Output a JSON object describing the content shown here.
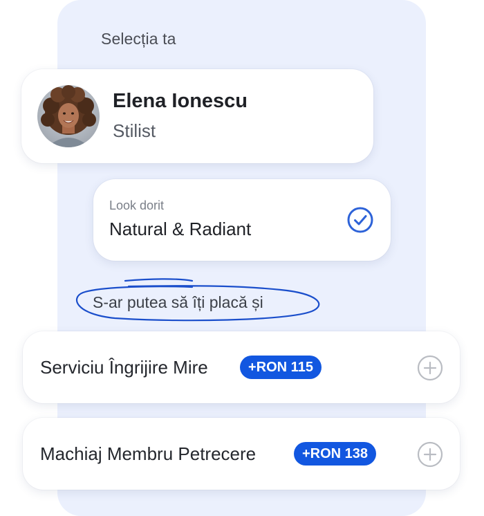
{
  "selection": {
    "title": "Selecția ta"
  },
  "stylist": {
    "name": "Elena Ionescu",
    "role": "Stilist",
    "avatar": "avatar-photo"
  },
  "look": {
    "label": "Look dorit",
    "value": "Natural & Radiant",
    "selected": true,
    "icon": "check-circle-icon"
  },
  "suggestions": {
    "heading": "S-ar putea să îți placă și",
    "items": [
      {
        "name": "Serviciu Îngrijire Mire",
        "price": "+RON 115",
        "icon": "plus-circle-icon"
      },
      {
        "name": "Machiaj Membru Petrecere",
        "price": "+RON 138",
        "icon": "plus-circle-icon"
      }
    ]
  },
  "colors": {
    "panel": "#ebf0fd",
    "accent": "#1257e0",
    "check": "#2d62d8",
    "plus": "#b9bcc2"
  }
}
